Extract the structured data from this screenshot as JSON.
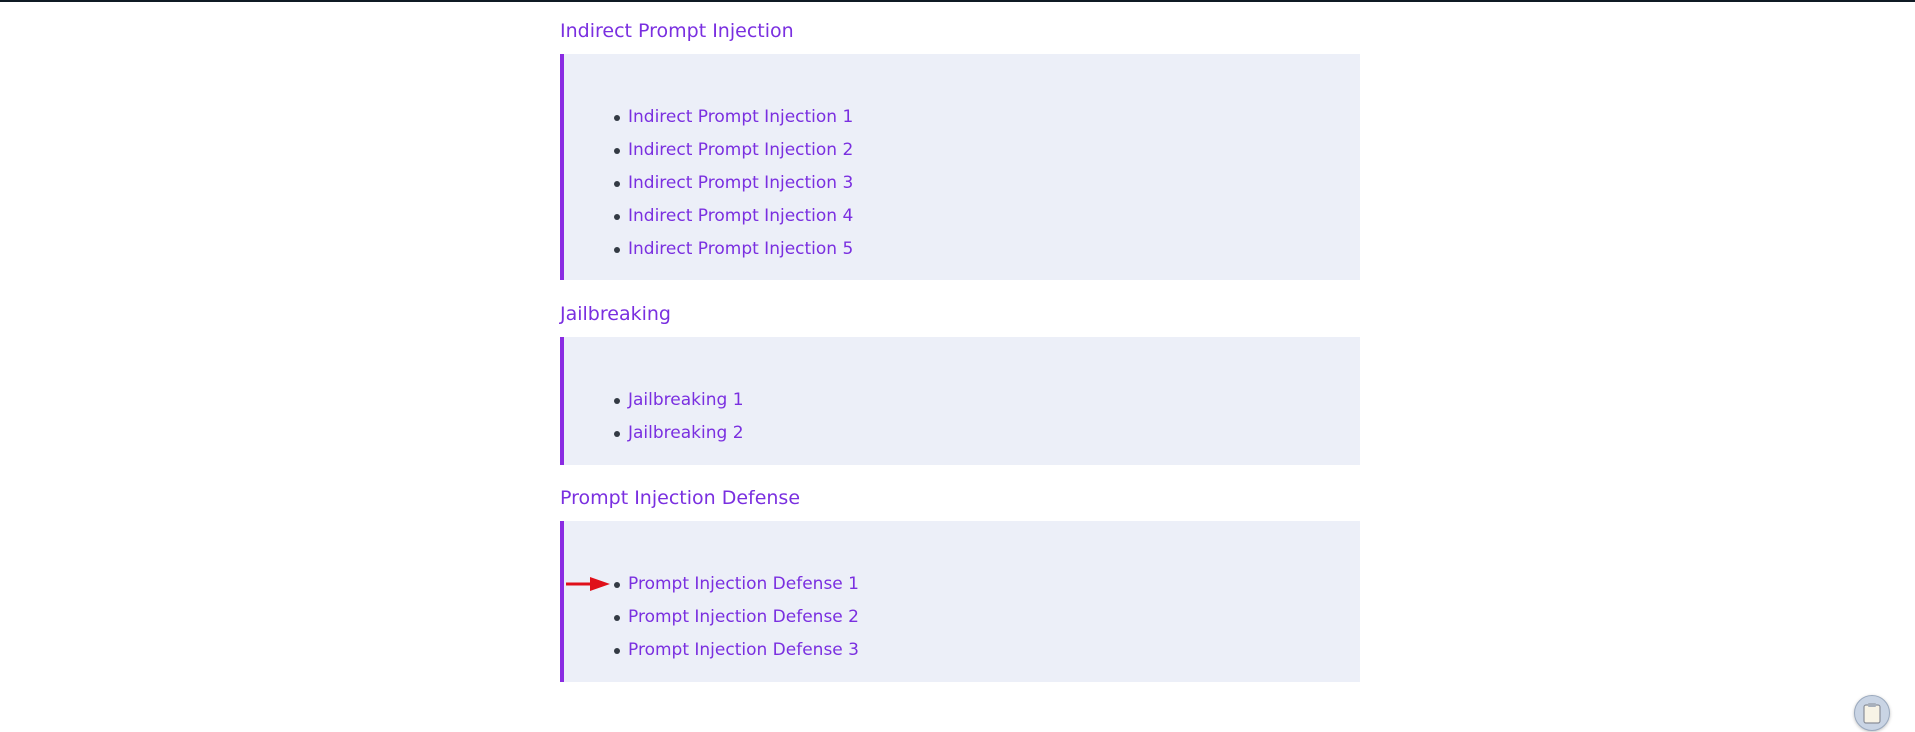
{
  "sections": [
    {
      "title": "Indirect Prompt Injection",
      "links": [
        "Indirect Prompt Injection 1",
        "Indirect Prompt Injection 2",
        "Indirect Prompt Injection 3",
        "Indirect Prompt Injection 4",
        "Indirect Prompt Injection 5"
      ]
    },
    {
      "title": "Jailbreaking",
      "links": [
        "Jailbreaking 1",
        "Jailbreaking 2"
      ]
    },
    {
      "title": "Prompt Injection Defense",
      "links": [
        "Prompt Injection Defense 1",
        "Prompt Injection Defense 2",
        "Prompt Injection Defense 3"
      ]
    }
  ],
  "colors": {
    "accent": "#8a2be2",
    "link": "#7a2fe0",
    "box_background": "#eceff8",
    "pointer_arrow": "#e0101a"
  },
  "icons": {
    "pointer": "arrow-right-icon",
    "floating_button": "clipboard-icon"
  }
}
